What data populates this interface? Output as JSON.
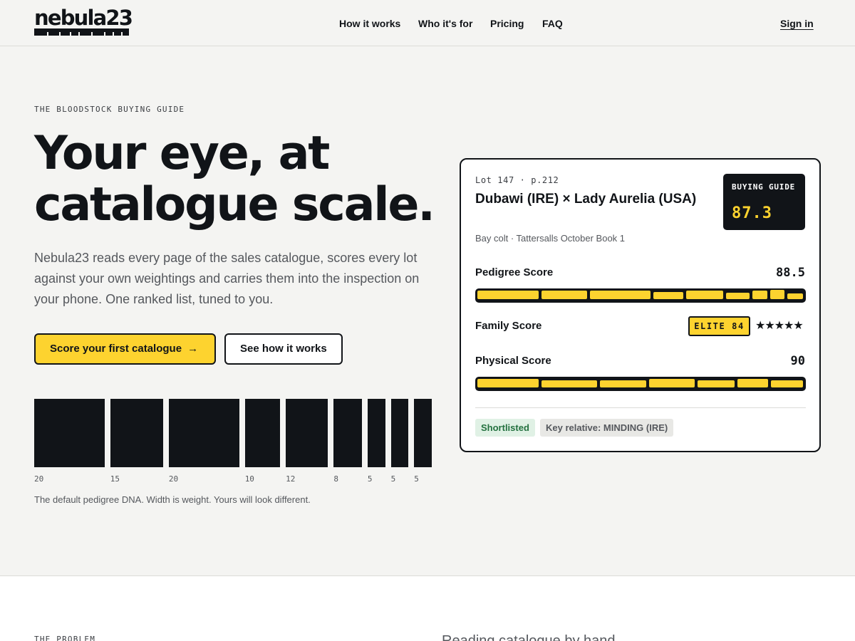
{
  "header": {
    "logo": "nebula23",
    "nav": [
      "How it works",
      "Who it's for",
      "Pricing",
      "FAQ"
    ],
    "signin": "Sign in"
  },
  "hero": {
    "eyebrow": "THE BLOODSTOCK BUYING GUIDE",
    "title_line1": "Your eye, at",
    "title_line2": "catalogue scale.",
    "subtitle": "Nebula23 reads every page of the sales catalogue, scores every lot against your own weightings and carries them into the inspection on your phone. One ranked list, tuned to you.",
    "primary_button": "Score your first catalogue",
    "primary_icon": "arrow-right-icon",
    "secondary_button": "See how it works",
    "dna_weights": [
      20,
      15,
      20,
      10,
      12,
      8,
      5,
      5,
      5
    ],
    "dna_labels": [
      "20",
      "15",
      "20",
      "10",
      "12",
      "8",
      "5",
      "5",
      "5"
    ],
    "dna_caption": "The default pedigree DNA. Width is weight. Yours will look different."
  },
  "card": {
    "lot": "Lot 147 · p.212",
    "title": "Dubawi (IRE) × Lady Aurelia (USA)",
    "description": "Bay colt · Tattersalls October Book 1",
    "guide_label": "BUYING GUIDE",
    "guide_value": "87.3",
    "pedigree_label": "Pedigree Score",
    "pedigree_value": "88.5",
    "family_label": "Family Score",
    "family_badge": "ELITE 84",
    "family_stars": "★★★★★",
    "physical_label": "Physical Score",
    "physical_value": "90",
    "chip_shortlisted": "Shortlisted",
    "chip_relative": "Key relative: MINDING (IRE)"
  },
  "problem": {
    "eyebrow": "THE PROBLEM",
    "text": "Reading catalogue by hand ..."
  },
  "colors": {
    "accent": "#fdd32f",
    "ink": "#111418",
    "background": "#f4f4f2",
    "success": "#23713f"
  }
}
